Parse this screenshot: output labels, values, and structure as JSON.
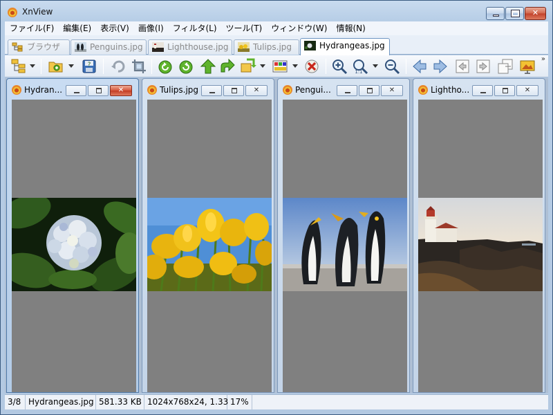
{
  "window": {
    "title": "XnView"
  },
  "menu": [
    "ファイル(F)",
    "編集(E)",
    "表示(V)",
    "画像(I)",
    "フィルタ(L)",
    "ツール(T)",
    "ウィンドウ(W)",
    "情報(N)"
  ],
  "tabs": [
    {
      "label": "ブラウザ",
      "icon": "browser-tree-icon",
      "active": false
    },
    {
      "label": "Penguins.jpg",
      "icon": "penguins-thumb-icon",
      "active": false
    },
    {
      "label": "Lighthouse.jpg",
      "icon": "lighthouse-thumb-icon",
      "active": false
    },
    {
      "label": "Tulips.jpg",
      "icon": "tulips-thumb-icon",
      "active": false
    },
    {
      "label": "Hydrangeas.jpg",
      "icon": "hydrangeas-thumb-icon",
      "active": true
    }
  ],
  "toolbar": {
    "icons": [
      "browser-icon",
      "open-folder-icon",
      "save-icon",
      "undo-icon",
      "crop-icon",
      "rotate-left-icon",
      "rotate-right-icon",
      "move-up-icon",
      "forward-icon",
      "convert-icon",
      "adjust-icon",
      "delete-icon",
      "zoom-in-icon",
      "zoom-icon",
      "zoom-out-icon",
      "previous-icon",
      "next-icon",
      "first-page-icon",
      "last-page-icon",
      "copy-icon",
      "slideshow-icon"
    ],
    "overflow": "»"
  },
  "child_windows": [
    {
      "title": "Hydran...",
      "active": true,
      "image": "hydrangea"
    },
    {
      "title": "Tulips.jpg",
      "active": false,
      "image": "tulips"
    },
    {
      "title": "Pengui...",
      "active": false,
      "image": "penguins"
    },
    {
      "title": "Lightho...",
      "active": false,
      "image": "lighthouse"
    }
  ],
  "status": {
    "position": "3/8",
    "filename": "Hydrangeas.jpg",
    "filesize": "581.33 KB",
    "dimensions": "1024x768x24, 1.33",
    "zoom": "17%"
  },
  "colors": {
    "viewer_background": "#808080",
    "close_button": "#c1402a",
    "frame": "#b3c9e2"
  }
}
